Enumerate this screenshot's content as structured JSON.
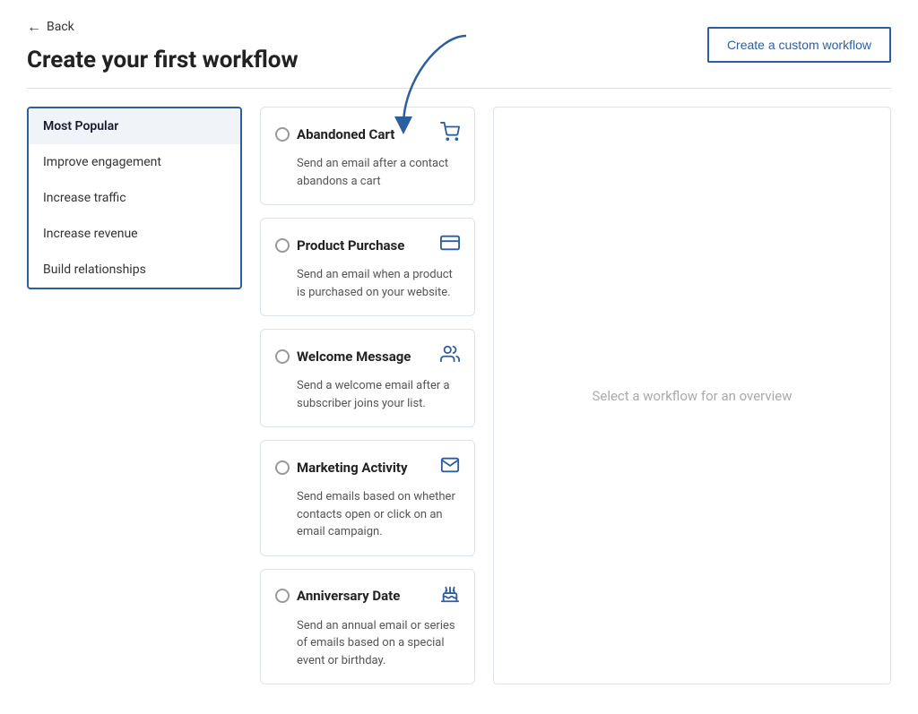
{
  "header": {
    "back_label": "Back",
    "page_title": "Create your first workflow",
    "custom_btn_label": "Create a custom workflow"
  },
  "sidebar": {
    "items": [
      {
        "id": "most-popular",
        "label": "Most Popular",
        "active": true
      },
      {
        "id": "improve-engagement",
        "label": "Improve engagement",
        "active": false
      },
      {
        "id": "increase-traffic",
        "label": "Increase traffic",
        "active": false
      },
      {
        "id": "increase-revenue",
        "label": "Increase revenue",
        "active": false
      },
      {
        "id": "build-relationships",
        "label": "Build relationships",
        "active": false
      }
    ]
  },
  "workflows": [
    {
      "id": "abandoned-cart",
      "title": "Abandoned Cart",
      "description": "Send an email after a contact abandons a cart",
      "icon": "🛒"
    },
    {
      "id": "product-purchase",
      "title": "Product Purchase",
      "description": "Send an email when a product is purchased on your website.",
      "icon": "💳"
    },
    {
      "id": "welcome-message",
      "title": "Welcome Message",
      "description": "Send a welcome email after a subscriber joins your list.",
      "icon": "🤝"
    },
    {
      "id": "marketing-activity",
      "title": "Marketing Activity",
      "description": "Send emails based on whether contacts open or click on an email campaign.",
      "icon": "✉️"
    },
    {
      "id": "anniversary-date",
      "title": "Anniversary Date",
      "description": "Send an annual email or series of emails based on a special event or birthday.",
      "icon": "🎂"
    }
  ],
  "right_panel": {
    "placeholder": "Select a workflow for an overview"
  }
}
